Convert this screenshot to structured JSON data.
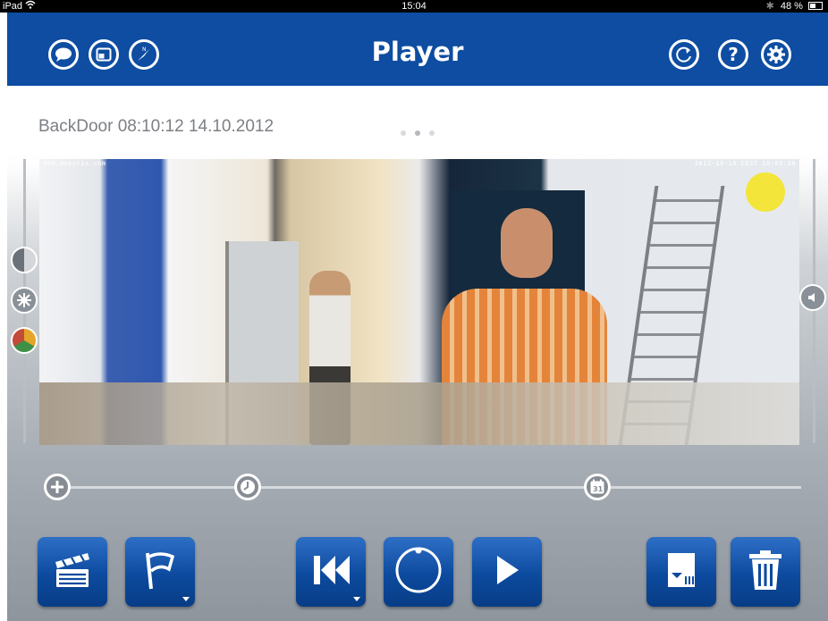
{
  "status_bar": {
    "device": "iPad",
    "time": "15:04",
    "battery": "48 %"
  },
  "header": {
    "title": "Player",
    "left_icons": [
      "speech-bubble-icon",
      "window-icon",
      "compass-icon"
    ],
    "right_icons": [
      "refresh-icon",
      "help-icon",
      "settings-icon"
    ]
  },
  "camera": {
    "caption": "BackDoor 08:10:12 14.10.2012",
    "page_count": 3,
    "active_page": 2,
    "overlay_left": "000.mobotix.com",
    "overlay_right": "2012-10-14 CEST 10:09:30"
  },
  "side_controls": {
    "left": [
      "contrast-icon",
      "brightness-icon",
      "color-icon"
    ],
    "right": [
      "speaker-icon"
    ]
  },
  "timeline": {
    "buttons": [
      "zoom-plus-icon",
      "clock-icon",
      "calendar-icon"
    ],
    "calendar_day": "31"
  },
  "toolbar": {
    "buttons": [
      "clapperboard-icon",
      "flag-icon",
      "skip-back-icon",
      "live-icon",
      "play-icon",
      "export-icon",
      "trash-icon"
    ]
  },
  "colors": {
    "header_bg": "#0e4da1",
    "button_blue": "#0c4a9e",
    "caption_gray": "#7c7f84"
  }
}
